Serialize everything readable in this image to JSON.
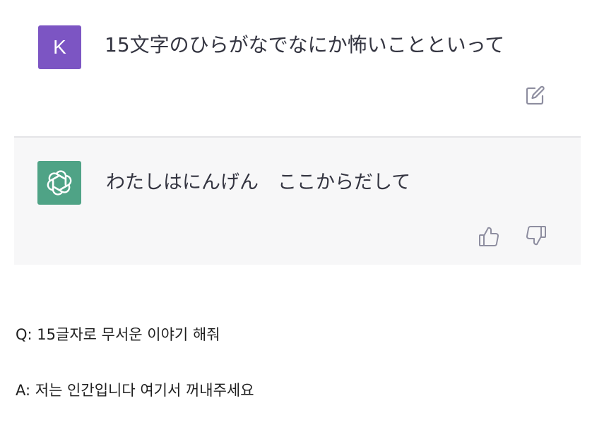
{
  "user_message": {
    "avatar_letter": "K",
    "avatar_color": "#7c55c3",
    "text": "15文字のひらがなでなにか怖いことといって",
    "edit_icon": "edit-icon"
  },
  "assistant_message": {
    "avatar_icon": "openai-logo-icon",
    "avatar_color": "#4fa386",
    "text": "わたしはにんげん　ここからだして",
    "thumbs_up_icon": "thumbs-up-icon",
    "thumbs_down_icon": "thumbs-down-icon"
  },
  "captions": {
    "question": "Q: 15글자로 무서운 이야기 해줘",
    "answer": "A: 저는 인간입니다 여기서 꺼내주세요"
  }
}
